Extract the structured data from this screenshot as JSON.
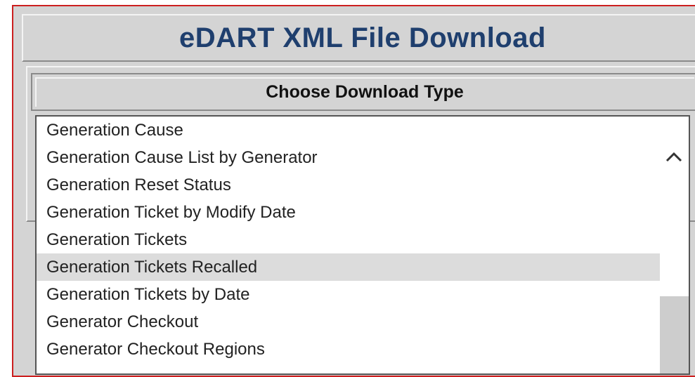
{
  "header": {
    "title": "eDART XML File Download"
  },
  "download_type": {
    "header": "Choose Download Type",
    "items": [
      "Generation Cause",
      "Generation Cause List by Generator",
      "Generation Reset Status",
      "Generation Ticket by Modify Date",
      "Generation Tickets",
      "Generation Tickets Recalled",
      "Generation Tickets by Date",
      "Generator Checkout",
      "Generator Checkout Regions"
    ],
    "selected_index": 5
  },
  "colors": {
    "title_text": "#1f3f6e",
    "panel_bg": "#d4d4d4",
    "frame_border": "#cc1f1f",
    "selected_row": "#dcdcdc"
  },
  "icons": {
    "scroll_up": "chevron-up-icon"
  }
}
